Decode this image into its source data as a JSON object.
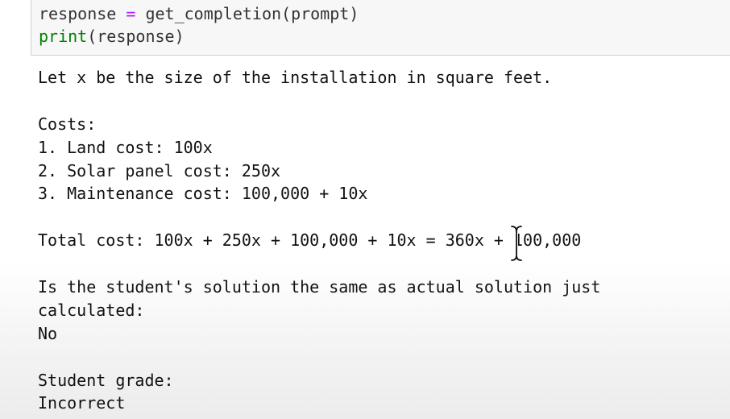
{
  "code_cell": {
    "line1": {
      "lhs": "response ",
      "operator": "=",
      "rhs": " get_completion(prompt)"
    },
    "line2": {
      "builtin": "print",
      "args": "(response)"
    }
  },
  "output_lines": [
    "Let x be the size of the installation in square feet.",
    "",
    "Costs:",
    "1. Land cost: 100x",
    "2. Solar panel cost: 250x",
    "3. Maintenance cost: 100,000 + 10x",
    "",
    "Total cost: 100x + 250x + 100,000 + 10x = 360x + 100,000",
    "",
    "Is the student's solution the same as actual solution just",
    "calculated:",
    "No",
    "",
    "Student grade:",
    "Incorrect"
  ],
  "colors": {
    "code_background": "#f7f7f7",
    "code_border": "#cfcfcf",
    "operator": "#aa22ff",
    "builtin": "#008000",
    "text": "#111111"
  },
  "icons": {
    "mouse_cursor": "text-ibeam-cursor-icon"
  }
}
